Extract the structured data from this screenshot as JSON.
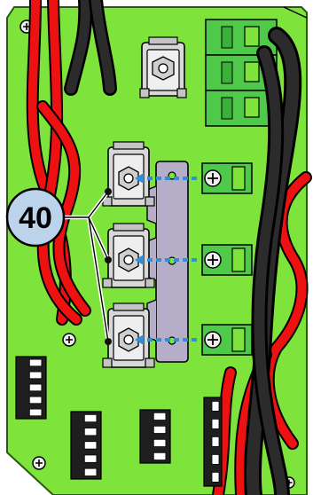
{
  "callout": {
    "number": "40",
    "circle_fill": "#bcd3ec",
    "circle_stroke": "#000000"
  },
  "colors": {
    "board": "#7ee33a",
    "board_edge": "#2a5a10",
    "cable_red": "#ee1111",
    "cable_black": "#1a1a1a",
    "terminal_green": "#4ec94a",
    "busbar": "#b6aec8",
    "arrow_blue": "#2f8fd8",
    "lug_gray": "#d8d8d8",
    "connector_dark": "#1e1e1e"
  },
  "elements": {
    "lug_count": 3,
    "screw_terminal_count": 3,
    "connector_block_count": 4
  }
}
